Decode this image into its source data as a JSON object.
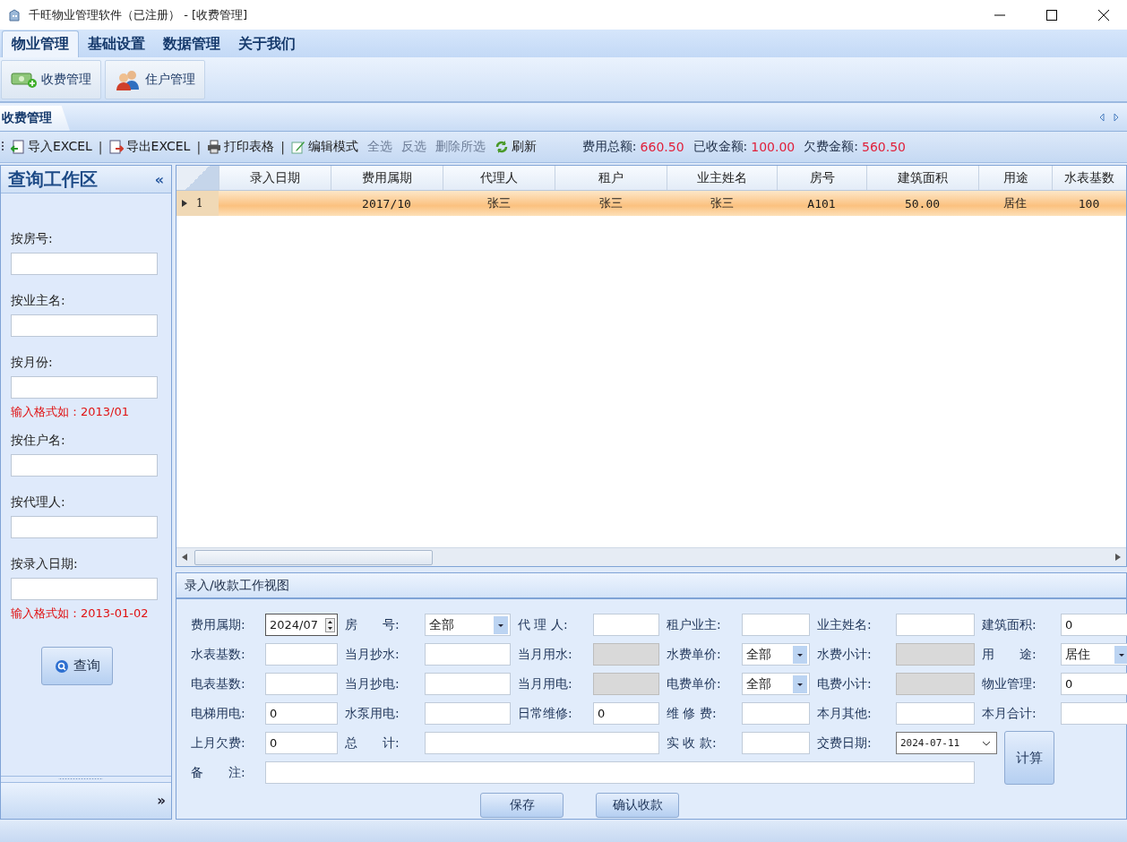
{
  "window": {
    "title": "千旺物业管理软件（已注册） - [收费管理]"
  },
  "menu": [
    {
      "label": "物业管理",
      "selected": true
    },
    {
      "label": "基础设置",
      "selected": false
    },
    {
      "label": "数据管理",
      "selected": false
    },
    {
      "label": "关于我们",
      "selected": false
    }
  ],
  "ribbon": [
    {
      "label": "收费管理",
      "kind": "money"
    },
    {
      "label": "住户管理",
      "kind": "people"
    }
  ],
  "doc_tabs": [
    {
      "label": "收费管理",
      "selected": true
    }
  ],
  "toolbar": [
    {
      "kind": "import",
      "label": "导入EXCEL",
      "disabled": false
    },
    {
      "kind": "separator",
      "label": "|"
    },
    {
      "kind": "export",
      "label": "导出EXCEL",
      "disabled": false
    },
    {
      "kind": "separator",
      "label": "|"
    },
    {
      "kind": "print",
      "label": "打印表格",
      "disabled": false
    },
    {
      "kind": "separator",
      "label": "|"
    },
    {
      "kind": "edit",
      "label": "编辑模式",
      "disabled": false
    },
    {
      "kind": "plain",
      "label": "全选",
      "disabled": true
    },
    {
      "kind": "plain",
      "label": "反选",
      "disabled": true
    },
    {
      "kind": "plain",
      "label": "删除所选",
      "disabled": true
    },
    {
      "kind": "refresh",
      "label": "刷新",
      "disabled": false
    }
  ],
  "summary": [
    {
      "label": "费用总额:",
      "value": "660.50"
    },
    {
      "label": "已收金额:",
      "value": "100.00"
    },
    {
      "label": "欠费金额:",
      "value": "560.50"
    }
  ],
  "sidebar": {
    "title": "查询工作区",
    "collapse": "«",
    "expand": "»",
    "fields": [
      {
        "label": "按房号:"
      },
      {
        "label": "按业主名:"
      },
      {
        "label": "按月份:",
        "hint": "输入格式如：2013/01"
      },
      {
        "label": "按住户名:"
      },
      {
        "label": "按代理人:"
      },
      {
        "label": "按录入日期:",
        "hint": "输入格式如：2013-01-02"
      }
    ],
    "button": "查询"
  },
  "table": {
    "columns": [
      "录入日期",
      "费用属期",
      "代理人",
      "租户",
      "业主姓名",
      "房号",
      "建筑面积",
      "用途",
      "水表基数"
    ],
    "rows": [
      {
        "number": "1",
        "selected": true,
        "cells": [
          null,
          "2017/10",
          "张三",
          "张三",
          "张三",
          "A101",
          "50.00",
          "居住",
          "100"
        ]
      }
    ]
  },
  "form": {
    "title": "录入/收款工作视图",
    "fields": [
      {
        "label": "费用属期:",
        "kind": "spin",
        "value": "2024/07"
      },
      {
        "label": "房　　号:",
        "kind": "select",
        "value": "全部"
      },
      {
        "label": "代 理 人:",
        "kind": "text",
        "disabled": false
      },
      {
        "label": "租户业主:",
        "kind": "text",
        "disabled": false
      },
      {
        "label": "业主姓名:",
        "kind": "text",
        "disabled": false
      },
      {
        "label": "建筑面积:",
        "kind": "text",
        "value": "0",
        "disabled": false
      },
      {
        "label": "水表基数:",
        "kind": "text",
        "disabled": false
      },
      {
        "label": "当月抄水:",
        "kind": "text",
        "disabled": false
      },
      {
        "label": "当月用水:",
        "kind": "text",
        "disabled": true
      },
      {
        "label": "水费单价:",
        "kind": "select",
        "value": "全部"
      },
      {
        "label": "水费小计:",
        "kind": "text",
        "disabled": true
      },
      {
        "label": "用　　途:",
        "kind": "select",
        "value": "居住"
      },
      {
        "label": "电表基数:",
        "kind": "text",
        "disabled": false
      },
      {
        "label": "当月抄电:",
        "kind": "text",
        "disabled": false
      },
      {
        "label": "当月用电:",
        "kind": "text",
        "disabled": true
      },
      {
        "label": "电费单价:",
        "kind": "select",
        "value": "全部"
      },
      {
        "label": "电费小计:",
        "kind": "text",
        "disabled": true
      },
      {
        "label": "物业管理:",
        "kind": "text",
        "value": "0",
        "disabled": false
      },
      {
        "label": "电梯用电:",
        "kind": "text",
        "value": "0",
        "disabled": false
      },
      {
        "label": "水泵用电:",
        "kind": "text",
        "disabled": false
      },
      {
        "label": "日常维修:",
        "kind": "text",
        "value": "0",
        "disabled": false
      },
      {
        "label": "维 修 费:",
        "kind": "text",
        "disabled": false
      },
      {
        "label": "本月其他:",
        "kind": "text",
        "disabled": false
      },
      {
        "label": "本月合计:",
        "kind": "text",
        "disabled": false
      },
      {
        "label": "上月欠费:",
        "kind": "text",
        "value": "0",
        "disabled": false
      },
      {
        "label": "总　　计:",
        "kind": "total",
        "disabled": false
      },
      {
        "label": "实 收 款:",
        "kind": "text",
        "disabled": false
      },
      {
        "label": "交费日期:",
        "kind": "date",
        "value": "2024-07-11"
      },
      {
        "label": "备　　注:",
        "kind": "note",
        "disabled": false
      }
    ],
    "calc_button": "计算",
    "buttons": [
      "保存",
      "确认收款"
    ]
  }
}
